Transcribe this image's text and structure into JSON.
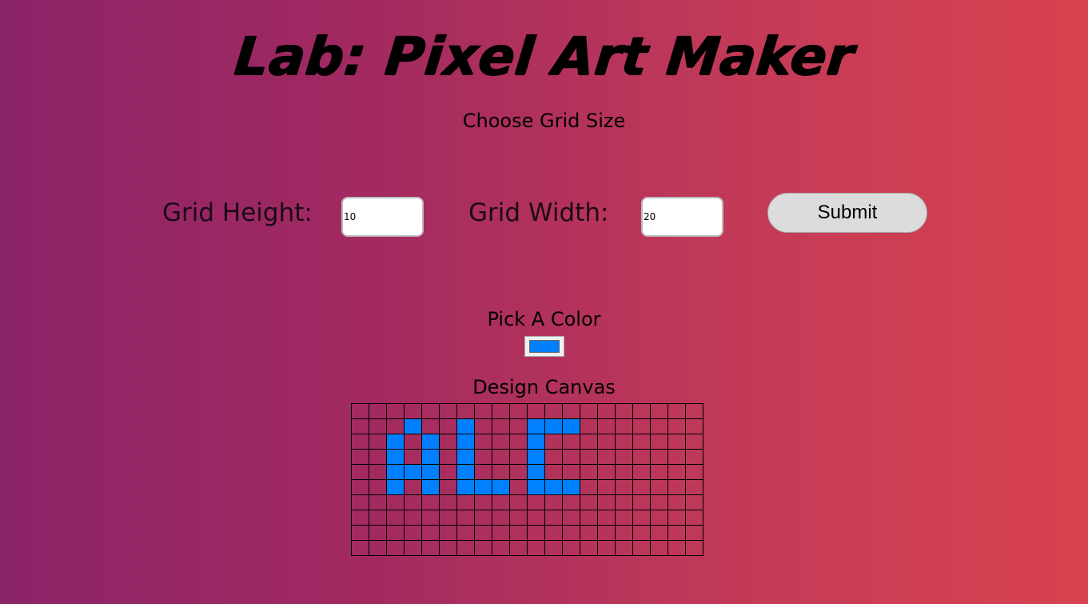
{
  "title": "Lab: Pixel Art Maker",
  "grid_size_heading": "Choose Grid Size",
  "form": {
    "height_label": "Grid Height:",
    "height_value": "10",
    "width_label": "Grid Width:",
    "width_value": "20",
    "submit_label": "Submit"
  },
  "color_heading": "Pick A Color",
  "selected_color": "#0080ff",
  "canvas_heading": "Design Canvas",
  "canvas": {
    "rows": 10,
    "cols": 20,
    "fill_color": "#0080ff",
    "filled_cells": [
      [
        1,
        3
      ],
      [
        1,
        6
      ],
      [
        1,
        10
      ],
      [
        1,
        11
      ],
      [
        1,
        12
      ],
      [
        2,
        2
      ],
      [
        2,
        4
      ],
      [
        2,
        6
      ],
      [
        2,
        10
      ],
      [
        3,
        2
      ],
      [
        3,
        4
      ],
      [
        3,
        6
      ],
      [
        3,
        10
      ],
      [
        4,
        2
      ],
      [
        4,
        3
      ],
      [
        4,
        4
      ],
      [
        4,
        6
      ],
      [
        4,
        10
      ],
      [
        5,
        2
      ],
      [
        5,
        4
      ],
      [
        5,
        6
      ],
      [
        5,
        7
      ],
      [
        5,
        8
      ],
      [
        5,
        10
      ],
      [
        5,
        11
      ],
      [
        5,
        12
      ]
    ]
  }
}
